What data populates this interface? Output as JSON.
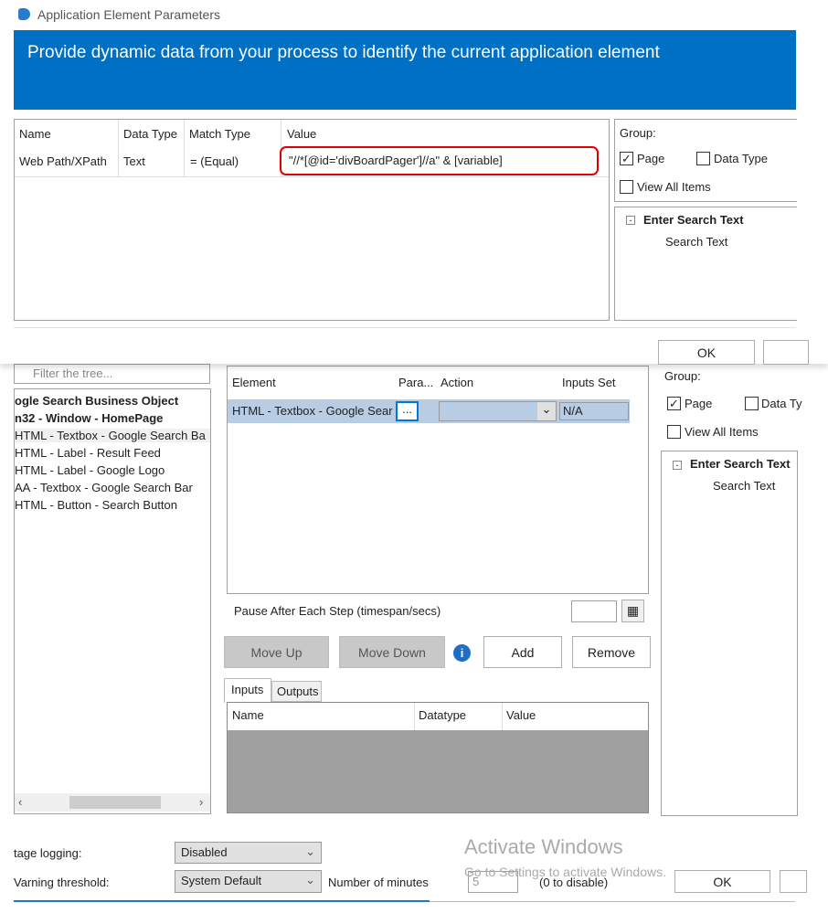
{
  "dialog": {
    "title": "Application Element Parameters",
    "banner": "Provide dynamic data from your process to identify the current application element",
    "columns": [
      "Name",
      "Data Type",
      "Match Type",
      "Value"
    ],
    "row": {
      "name": "Web Path/XPath",
      "data_type": "Text",
      "match_type": "=  (Equal)",
      "value": "\"//*[@id='divBoardPager']//a\" & [variable]"
    },
    "group_label": "Group:",
    "page_label": "Page",
    "data_type_label": "Data Type",
    "view_all_label": "View All Items",
    "tree_root": "Enter Search Text",
    "tree_child": "Search Text",
    "ok": "OK",
    "accent": "#0070c5",
    "highlight": "#e00000"
  },
  "bg": {
    "filter_placeholder": "Filter the tree...",
    "tree": [
      {
        "label": "ogle Search Business Object",
        "bold": true
      },
      {
        "label": "n32 - Window - HomePage",
        "bold": true
      },
      {
        "label": "HTML - Textbox - Google Search Ba"
      },
      {
        "label": "HTML - Label - Result Feed"
      },
      {
        "label": "HTML - Label - Google Logo"
      },
      {
        "label": "AA - Textbox - Google Search Bar"
      },
      {
        "label": "HTML - Button - Search Button"
      }
    ],
    "steps_columns": [
      "Element",
      "Para...",
      "Action",
      "Inputs Set"
    ],
    "step_row": {
      "element": "HTML - Textbox - Google Sear",
      "param": "...",
      "action": "",
      "inputs": "N/A"
    },
    "pause_label": "Pause After Each Step (timespan/secs)",
    "move_up": "Move Up",
    "move_down": "Move Down",
    "add": "Add",
    "remove": "Remove",
    "tabs": [
      "Inputs",
      "Outputs"
    ],
    "io_columns": [
      "Name",
      "Datatype",
      "Value"
    ],
    "group_label": "Group:",
    "page_label": "Page",
    "data_type_label": "Data Ty",
    "view_all_label": "View All Items",
    "tree_root": "Enter Search Text",
    "tree_child": "Search Text",
    "stage_logging_label": "tage logging:",
    "stage_logging_value": "Disabled",
    "warning_label": "Varning threshold:",
    "warning_value": "System Default",
    "minutes_label": "Number of minutes",
    "minutes_value": "5",
    "disable_hint": "(0 to disable)",
    "ok": "OK"
  },
  "watermark": {
    "title": "Activate Windows",
    "subtitle": "Go to Settings to activate Windows."
  }
}
